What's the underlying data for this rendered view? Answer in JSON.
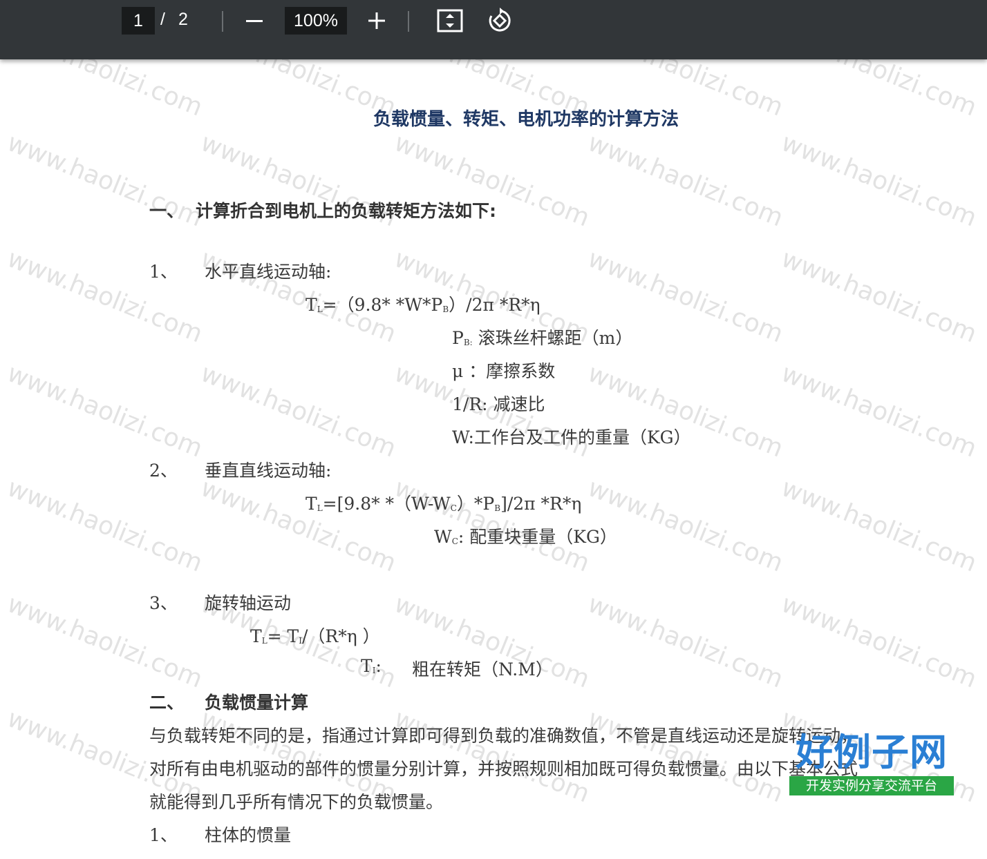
{
  "toolbar": {
    "current_page": "1",
    "separator": "/",
    "total_pages": "2",
    "zoom": "100%",
    "zoom_out_icon": "minus-icon",
    "zoom_in_icon": "plus-icon",
    "fit_icon": "fit-page-icon",
    "rotate_icon": "rotate-icon"
  },
  "watermark": "www.haolizi.com",
  "doc": {
    "title": "负载惯量、转矩、电机功率的计算方法",
    "sec1_num": "一、",
    "sec1_title": "计算折合到电机上的负载转矩方法如下:",
    "i1_num": "1、",
    "i1_title": "水平直线运动轴:",
    "f1_a": "T",
    "f1_a_sub": "L",
    "f1_b": "=（9.8* *W*P",
    "f1_b_sub": "B",
    "f1_c": "）/2π *R*η",
    "d1_a": "P",
    "d1_a_sub": "B:",
    "d1_b": " 滚珠丝杆螺距（m）",
    "d2": "μ ：摩擦系数",
    "d3": "1/R: 减速比",
    "d4": "W:工作台及工件的重量（KG）",
    "i2_num": "2、",
    "i2_title": "垂直直线运动轴:",
    "f2_a": "T",
    "f2_a_sub": "L",
    "f2_b": "=[9.8* *（W-W",
    "f2_b_sub": "C",
    "f2_c": "）*P",
    "f2_c_sub": "B",
    "f2_d": "]/2π *R*η",
    "d5_a": "W",
    "d5_a_sub": "C",
    "d5_b": ": 配重块重量（KG）",
    "i3_num": "3、",
    "i3_title": "旋转轴运动",
    "f3_a": "T",
    "f3_a_sub": "L",
    "f3_b": "= T",
    "f3_b_sub": "I",
    "f3_c": "/（R*η ）",
    "d6_a": "T",
    "d6_a_sub": "I",
    "d6_b": ":",
    "d6_c": "粗在转矩（N.M）",
    "sec2_num": "二、",
    "sec2_title": "负载惯量计算",
    "p1": "与负载转矩不同的是，指通过计算即可得到负载的准确数值，不管是直线运动还是旋转运动，",
    "p2": "对所有由电机驱动的部件的惯量分别计算，并按照规则相加既可得负载惯量。由以下基本公式",
    "p3": "就能得到几乎所有情况下的负载惯量。",
    "i4_num": "1、",
    "i4_title": "柱体的惯量"
  },
  "logo": {
    "main": "好例子网",
    "sub": "开发实例分享交流平台"
  }
}
